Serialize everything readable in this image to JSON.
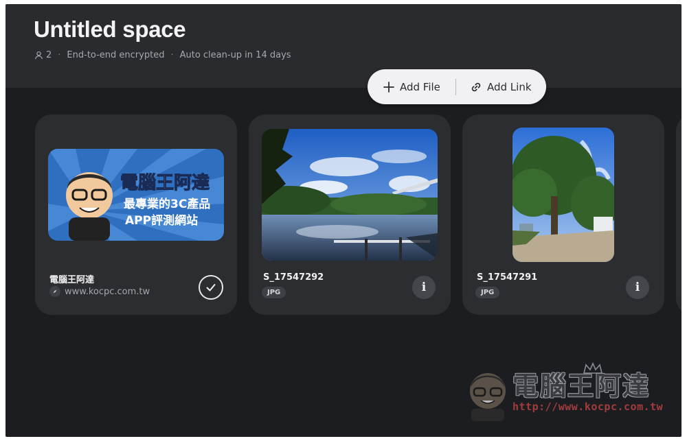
{
  "space": {
    "title": "Untitled space",
    "member_count": "2",
    "encryption": "End-to-end encrypted",
    "cleanup": "Auto clean-up in 14 days",
    "separator": "·"
  },
  "actions": {
    "add_file": "Add File",
    "add_link": "Add Link"
  },
  "cards": [
    {
      "type": "link",
      "name": "電腦王阿達",
      "url": "www.kocpc.com.tw",
      "banner": {
        "line1": "電腦王阿達",
        "line2": "最專業的3C產品",
        "line3": "APP評測網站"
      }
    },
    {
      "type": "file",
      "name": "S_17547292",
      "format": "JPG"
    },
    {
      "type": "file",
      "name": "S_17547291",
      "format": "JPG"
    }
  ],
  "info_glyph": "i",
  "watermark": {
    "title": "電腦王阿達",
    "url": "http://www.kocpc.com.tw"
  },
  "colors": {
    "background": "#1c1d21",
    "header": "#2a2b2f",
    "card": "#2c2d31",
    "pill": "#f1f1f3"
  }
}
